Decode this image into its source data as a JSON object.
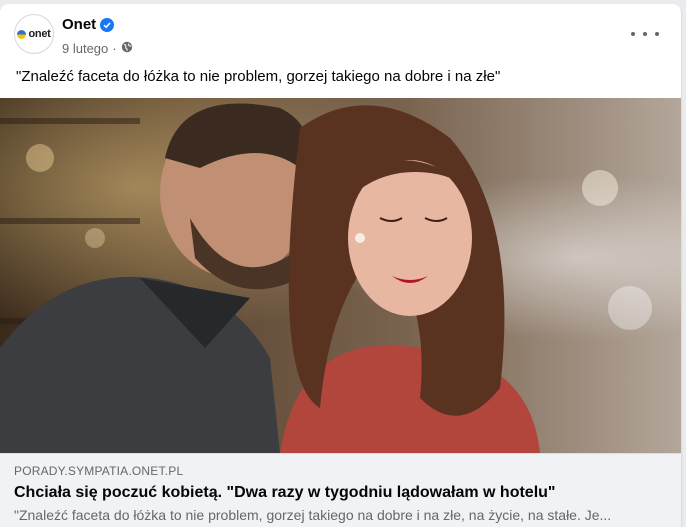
{
  "post": {
    "page_name": "Onet",
    "avatar_text": "onet",
    "date": "9 lutego",
    "separator": "·",
    "privacy_icon": "globe-icon",
    "verified_icon": "verified-badge-icon",
    "more_icon": "more-options-icon",
    "caption": "\"Znaleźć faceta do łóżka to nie problem, gorzej takiego na dobre i na złe\""
  },
  "link_preview": {
    "domain": "PORADY.SYMPATIA.ONET.PL",
    "headline": "Chciała się poczuć kobietą. \"Dwa razy w tygodniu lądowałam w hotelu\"",
    "description": "\"Znaleźć faceta do łóżka to nie problem, gorzej takiego na dobre i na złe, na życie, na stałe. Je..."
  },
  "colors": {
    "verified_blue": "#1877f2",
    "text_primary": "#050505",
    "text_secondary": "#65676b",
    "preview_bg": "#f0f2f5"
  }
}
